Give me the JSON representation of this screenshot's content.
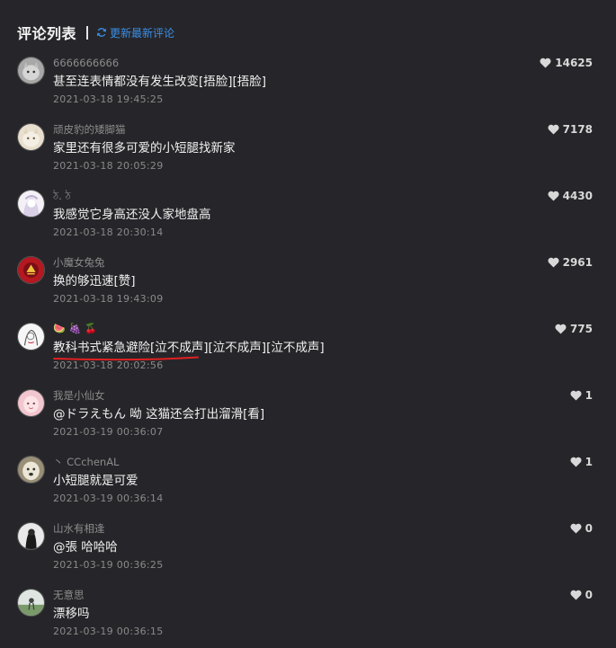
{
  "header": {
    "title": "评论列表",
    "refresh_label": "更新最新评论"
  },
  "colors": {
    "background": "#26262a",
    "accent": "#3a8fe8",
    "underline": "#e02020"
  },
  "comments": [
    {
      "user": "6666666666",
      "text": "甚至连表情都没有发生改变[捂脸][捂脸]",
      "time": "2021-03-18 19:45:25",
      "likes": "14625",
      "avatar": "cat-gray"
    },
    {
      "user": "顽皮豹的矮脚猫",
      "text": "家里还有很多可爱的小短腿找新家",
      "time": "2021-03-18 20:05:29",
      "likes": "7178",
      "avatar": "cat-cream"
    },
    {
      "user": "ঠ. ঠ",
      "text": "我感觉它身高还没人家地盘高",
      "time": "2021-03-18 20:30:14",
      "likes": "4430",
      "avatar": "anime-white"
    },
    {
      "user": "小魔女兔兔",
      "text": "换的够迅速[赞]",
      "time": "2021-03-18 19:43:09",
      "likes": "2961",
      "avatar": "red-logo"
    },
    {
      "user": "",
      "emojis": [
        "🍉",
        "🍇",
        "🍒"
      ],
      "text": "教科书式紧急避险[泣不成声][泣不成声][泣不成声]",
      "time": "2021-03-18 20:02:56",
      "likes": "775",
      "avatar": "anime-sketch"
    },
    {
      "user": "我是小仙女",
      "text": "@ドラえもん 呦 这猫还会打出溜滑[看]",
      "time": "2021-03-19 00:36:07",
      "likes": "1",
      "avatar": "pink-face"
    },
    {
      "user": "丶 CCchenAL",
      "text": "小短腿就是可爱",
      "time": "2021-03-19 00:36:14",
      "likes": "1",
      "avatar": "dog-white"
    },
    {
      "user": "山水有相逢",
      "text": "@張 哈哈哈",
      "time": "2021-03-19 00:36:25",
      "likes": "0",
      "avatar": "dark-figure"
    },
    {
      "user": "无意思",
      "text": "漂移吗",
      "time": "2021-03-19 00:36:15",
      "likes": "0",
      "avatar": "outdoor"
    }
  ]
}
